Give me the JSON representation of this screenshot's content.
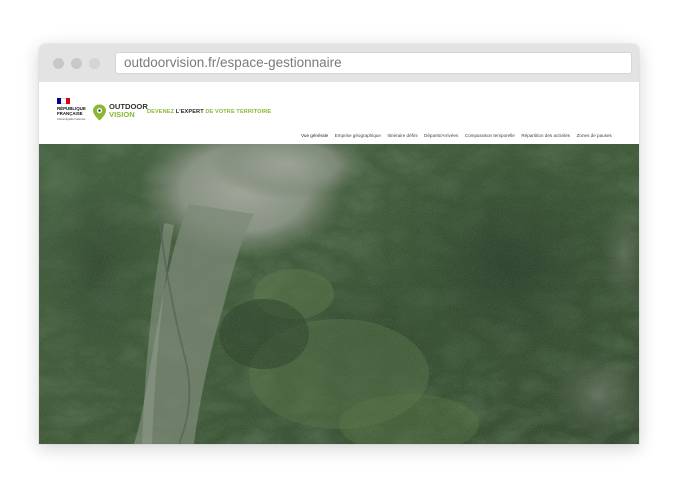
{
  "browser": {
    "url": "outdoorvision.fr/espace-gestionnaire"
  },
  "header": {
    "republique_line1": "RÉPUBLIQUE",
    "republique_line2": "FRANÇAISE",
    "republique_motto": "Liberté Égalité Fraternité",
    "brand_line1": "OUTDOOR",
    "brand_line2": "VISION",
    "tagline_part1": "DEVENEZ",
    "tagline_part2": "L'EXPERT",
    "tagline_part3": "DE VOTRE TERRITOIRE"
  },
  "nav": {
    "items": [
      {
        "label": "Vue générale",
        "active": true
      },
      {
        "label": "Emprise géographique",
        "active": false
      },
      {
        "label": "Itinéraire défini",
        "active": false
      },
      {
        "label": "Départs/Arrivées",
        "active": false
      },
      {
        "label": "Comparaison temporelle",
        "active": false
      },
      {
        "label": "Répartition des activités",
        "active": false
      },
      {
        "label": "Zones de pauses",
        "active": false
      }
    ]
  },
  "colors": {
    "brand_green": "#8ab832",
    "brand_dark": "#2f3a2a",
    "flag_blue": "#000091",
    "flag_red": "#e1000f"
  },
  "icons": {
    "window_controls": [
      "close-dot-icon",
      "minimize-dot-icon",
      "maximize-dot-icon"
    ],
    "brand": "outdoorvision-pin-icon"
  },
  "map": {
    "type": "satellite-imagery"
  }
}
